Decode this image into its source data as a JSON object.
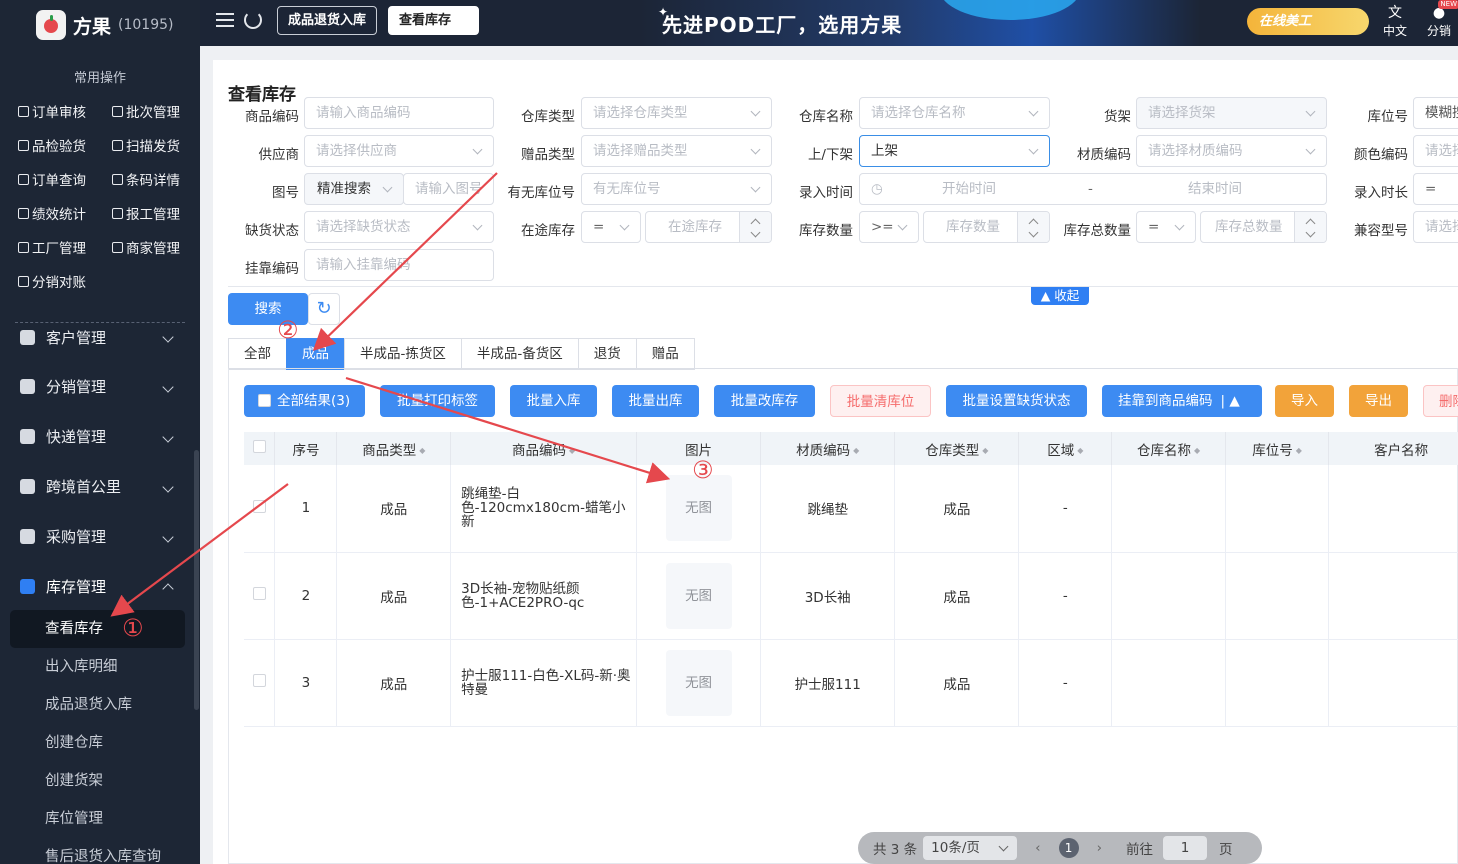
{
  "brand": {
    "name": "方果",
    "count": "(10195)"
  },
  "sidebar": {
    "common_title": "常用操作",
    "quick": [
      "订单审核",
      "批次管理",
      "品检验货",
      "扫描发货",
      "订单查询",
      "条码详情",
      "绩效统计",
      "报工管理",
      "工厂管理",
      "商家管理",
      "分销对账"
    ],
    "menus": [
      {
        "label": "客户管理",
        "icon": "customer-icon"
      },
      {
        "label": "分销管理",
        "icon": "distribution-icon"
      },
      {
        "label": "快递管理",
        "icon": "express-icon"
      },
      {
        "label": "跨境首公里",
        "icon": "globe-icon"
      },
      {
        "label": "采购管理",
        "icon": "purchase-icon"
      },
      {
        "label": "库存管理",
        "icon": "inventory-icon"
      }
    ],
    "subs": [
      "查看库存",
      "出入库明细",
      "成品退货入库",
      "创建仓库",
      "创建货架",
      "库位管理",
      "售后退货入库查询"
    ]
  },
  "header": {
    "tabs": [
      "成品退货入库",
      "查看库存"
    ],
    "slogan": "先进POD工厂，选用方果",
    "promo": "在线美工",
    "lang": "中文",
    "distribution": "分销",
    "badge": "NEW"
  },
  "page": {
    "title": "查看库存"
  },
  "filters": {
    "row1": [
      {
        "label": "商品编码",
        "placeholder": "请输入商品编码"
      },
      {
        "label": "仓库类型",
        "placeholder": "请选择仓库类型"
      },
      {
        "label": "仓库名称",
        "placeholder": "请选择仓库名称"
      },
      {
        "label": "货架",
        "placeholder": "请选择货架"
      },
      {
        "label": "库位号",
        "placeholder": "模糊搜"
      }
    ],
    "row2": [
      {
        "label": "供应商",
        "placeholder": "请选择供应商"
      },
      {
        "label": "赠品类型",
        "placeholder": "请选择赠品类型"
      },
      {
        "label": "上/下架",
        "value": "上架"
      },
      {
        "label": "材质编码",
        "placeholder": "请选择材质编码"
      },
      {
        "label": "颜色编码",
        "placeholder": "请选择"
      }
    ],
    "row3": {
      "tuhao": "图号",
      "match": "精准搜索",
      "tuhao_ph": "请输入图号",
      "kw_label": "有无库位号",
      "kw_ph": "有无库位号",
      "time_label": "录入时间",
      "start": "开始时间",
      "dash": "-",
      "end": "结束时间",
      "dur_label": "录入时长",
      "dur_op": "="
    },
    "row4": {
      "que_label": "缺货状态",
      "que_ph": "请选择缺货状态",
      "zt_label": "在途库存",
      "zt_op": "=",
      "zt_ph": "在途库存",
      "kc_label": "库存数量",
      "kc_op": ">=",
      "kc_ph": "库存数量",
      "zkc_label": "库存总数量",
      "zkc_op": "=",
      "zkc_ph": "库存总数量",
      "jr_label": "兼容型号",
      "jr_ph": "请选择"
    },
    "row5": {
      "label": "挂靠编码",
      "placeholder": "请输入挂靠编码"
    },
    "search": "搜索",
    "collapse": "收起"
  },
  "tabs": [
    "全部",
    "成品",
    "半成品-拣货区",
    "半成品-备货区",
    "退货",
    "赠品"
  ],
  "actions": {
    "all": "全部结果(3)",
    "print": "批量打印标签",
    "in": "批量入库",
    "out": "批量出库",
    "edit": "批量改库存",
    "clear": "批量清库位",
    "lack": "批量设置缺货状态",
    "attach": "挂靠到商品编码",
    "import": "导入",
    "export": "导出",
    "delete": "删除"
  },
  "table": {
    "columns": [
      "序号",
      "商品类型",
      "商品编码",
      "图片",
      "材质编码",
      "仓库类型",
      "区域",
      "仓库名称",
      "库位号",
      "客户名称"
    ],
    "rows": [
      {
        "no": "1",
        "type": "成品",
        "code": "跳绳垫-白色-120cmx180cm-蜡笔小新",
        "img": "无图",
        "material": "跳绳垫",
        "wh": "成品",
        "area": "-"
      },
      {
        "no": "2",
        "type": "成品",
        "code": "3D长袖-宠物贴纸颜色-1+ACE2PRO-qc",
        "img": "无图",
        "material": "3D长袖",
        "wh": "成品",
        "area": "-"
      },
      {
        "no": "3",
        "type": "成品",
        "code": "护士服111-白色-XL码-新·奥特曼",
        "img": "无图",
        "material": "护士服111",
        "wh": "成品",
        "area": "-"
      }
    ]
  },
  "pager": {
    "total": "共 3 条",
    "size": "10条/页",
    "page": "1",
    "goto": "前往",
    "jump": "1",
    "unit": "页"
  },
  "annotations": [
    "①",
    "②",
    "③"
  ],
  "colors": {
    "primary": "#3d8bf2",
    "sidebar": "#1d2635",
    "arrow": "#e5484d",
    "warn": "#f2a33a"
  }
}
